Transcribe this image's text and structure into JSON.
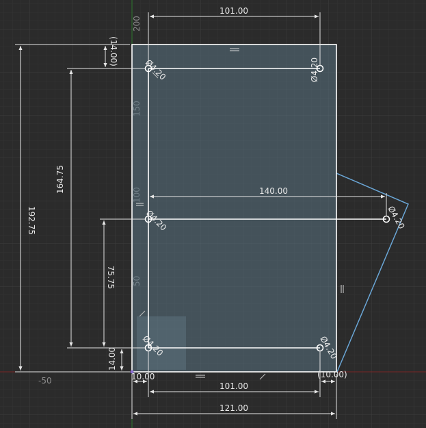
{
  "axis_labels": {
    "y_200": "200",
    "y_150": "150",
    "y_100": "100",
    "y_50": "50",
    "x_minus_50": "-50"
  },
  "dimensions": {
    "top_width": "101.00",
    "bottom_width": "101.00",
    "overall_width": "121.00",
    "hole_spacing_horizontal": "140.00",
    "overall_height": "192.75",
    "hole_top_from_bottom": "164.75",
    "hole_middle_from_bottom": "75.75",
    "hole_bottom_from_bottom": "14.00",
    "top_offset": "(14.00)",
    "left_offset": "10.00",
    "right_offset": "(10.00)"
  },
  "holes": {
    "top_left": "Ø4.20",
    "top_right": "Ø4.20",
    "middle_left": "Ø4.20",
    "middle_right": "Ø4.20",
    "bottom_left": "Ø4.20",
    "bottom_right": "Ø4.20"
  },
  "colors": {
    "background": "#2b2b2b",
    "grid_minor": "#343434",
    "grid_major": "#3d3d3d",
    "profile_fill": "#5a7282",
    "sketch_line": "#ffffff",
    "construction_line": "#6aa6d6",
    "origin_x_axis": "#7a2626",
    "origin_y_axis": "#2e7a2e"
  }
}
